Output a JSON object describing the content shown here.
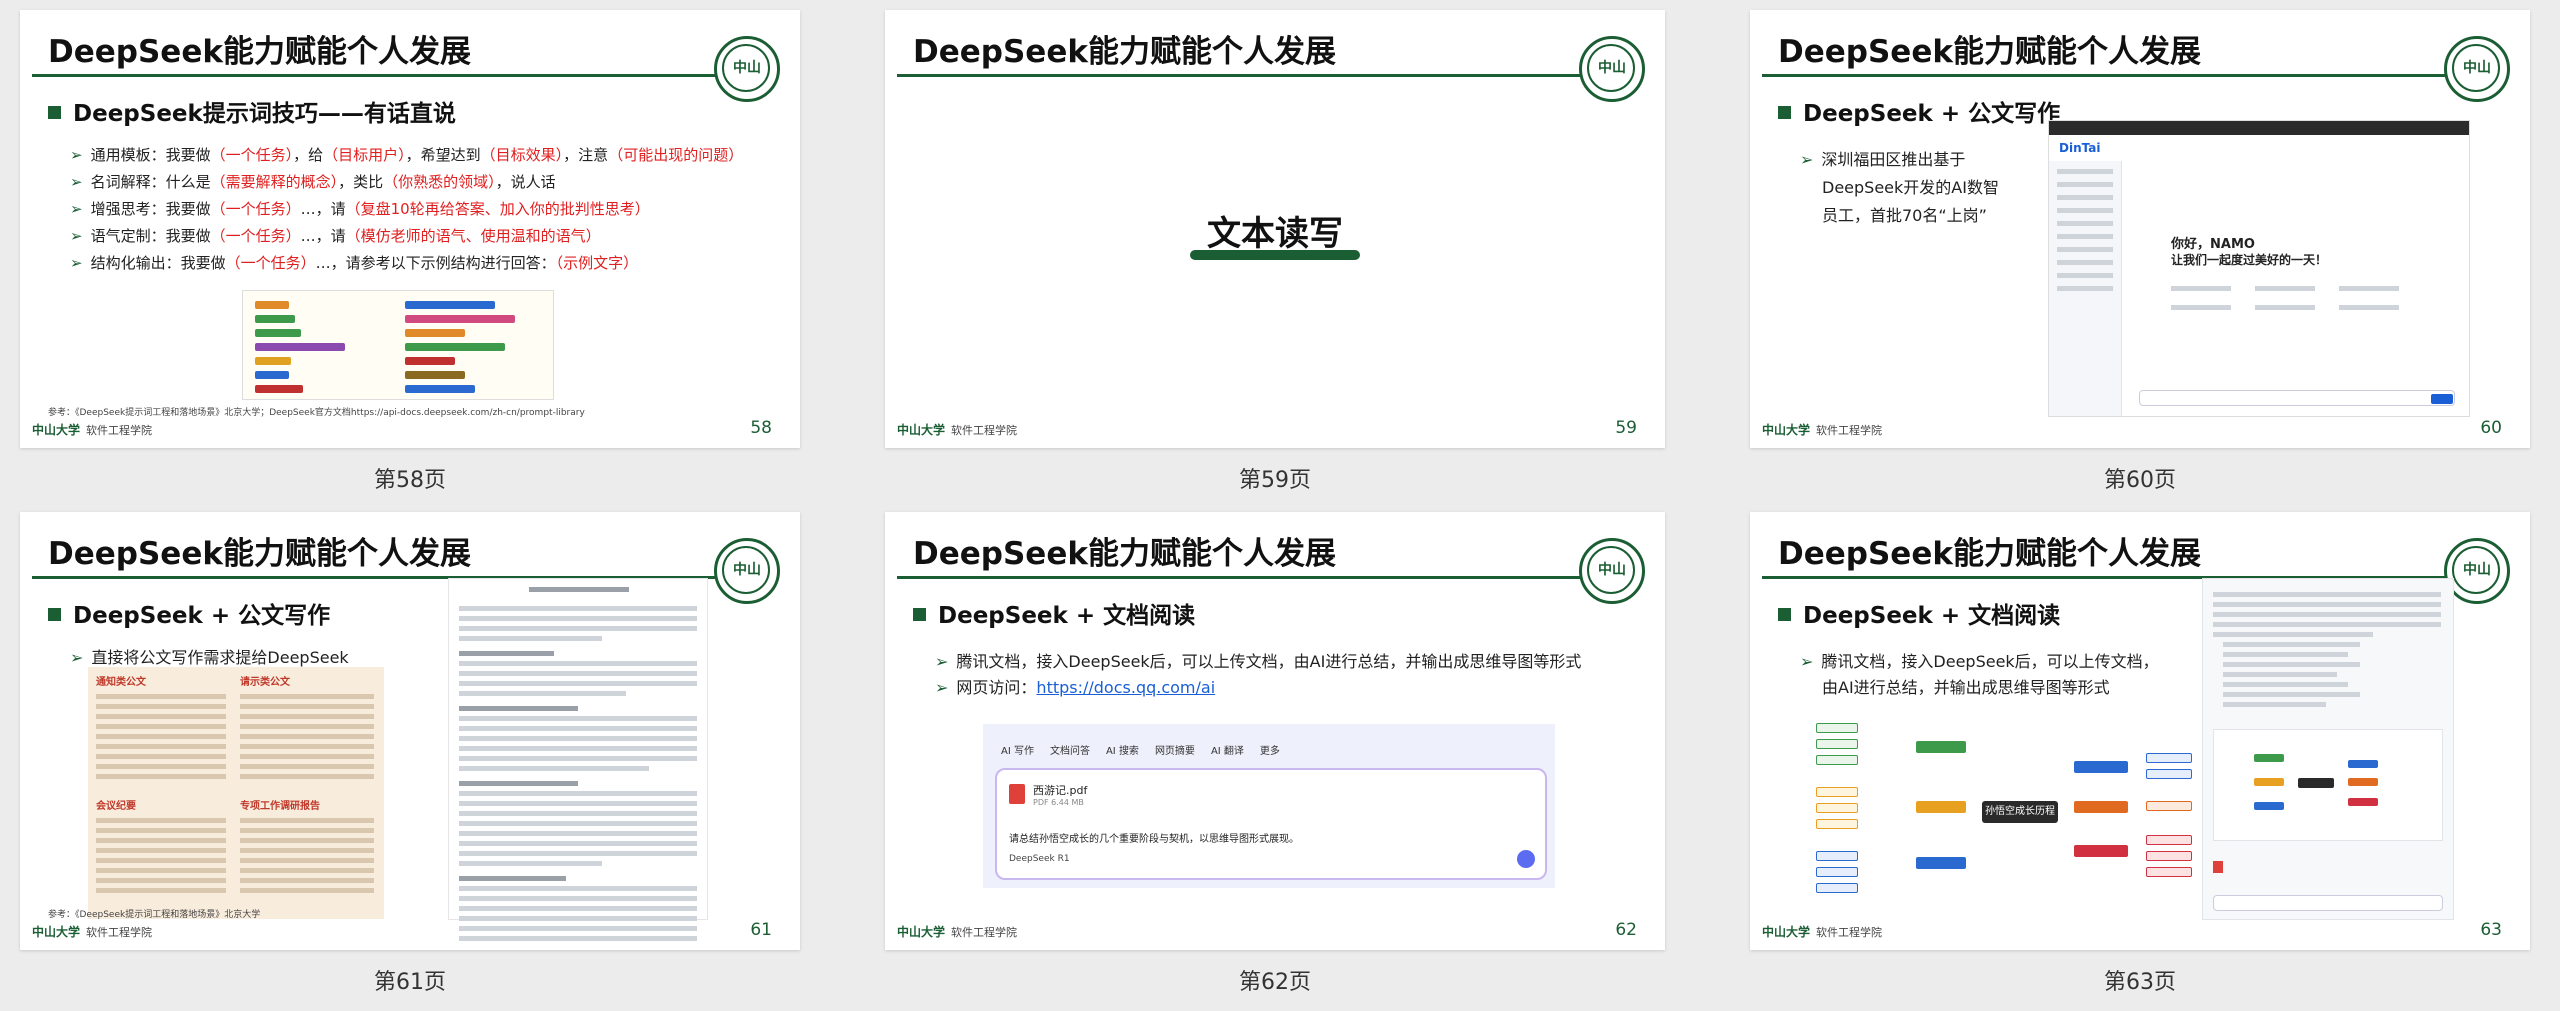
{
  "slides": [
    {
      "title": "DeepSeek能力赋能个人发展",
      "section": "DeepSeek提示词技巧——有话直说",
      "bullets": [
        {
          "prefix": "通用模板：我要做",
          "r1": "（一个任务）",
          "m1": "，给",
          "r2": "（目标用户）",
          "m2": "，希望达到",
          "r3": "（目标效果）",
          "m3": "，注意",
          "r4": "（可能出现的问题）"
        },
        {
          "prefix": "名词解释：什么是",
          "r1": "（需要解释的概念）",
          "m1": "，类比",
          "r2": "（你熟悉的领域）",
          "m2": "，说人话"
        },
        {
          "prefix": "增强思考：我要做",
          "r1": "（一个任务）",
          "m1": "…，请",
          "r2": "（复盘10轮再给答案、加入你的批判性思考）"
        },
        {
          "prefix": "语气定制：我要做",
          "r1": "（一个任务）",
          "m1": "…，请",
          "r2": "（模仿老师的语气、使用温和的语气）"
        },
        {
          "prefix": "结构化输出：我要做",
          "r1": "（一个任务）",
          "m1": "…，请参考以下示例结构进行回答：",
          "r2": "（示例文字）"
        }
      ],
      "ref": "参考：《DeepSeek提示词工程和落地场景》北京大学；DeepSeek官方文档https://api-docs.deepseek.com/zh-cn/prompt-library",
      "footer_logo": "中山大学",
      "footer_text": "软件工程学院",
      "page": "58",
      "caption": "第58页"
    },
    {
      "title": "DeepSeek能力赋能个人发展",
      "center": "文本读写",
      "footer_logo": "中山大学",
      "footer_text": "软件工程学院",
      "page": "59",
      "caption": "第59页"
    },
    {
      "title": "DeepSeek能力赋能个人发展",
      "section": "DeepSeek + 公文写作",
      "bullet_lines": [
        "深圳福田区推出基于",
        "DeepSeek开发的AI数智",
        "员工，首批70名“上岗”"
      ],
      "app_name": "DinTai",
      "app_greeting_1": "你好，NAMO",
      "app_greeting_2": "让我们一起度过美好的一天！",
      "footer_logo": "中山大学",
      "footer_text": "软件工程学院",
      "page": "60",
      "caption": "第60页"
    },
    {
      "title": "DeepSeek能力赋能个人发展",
      "section": "DeepSeek + 公文写作",
      "bullet": "直接将公文写作需求提给DeepSeek",
      "doc_labels": [
        "通知类公文",
        "请示类公文",
        "会议纪要",
        "专项工作调研报告"
      ],
      "ref": "参考：《DeepSeek提示词工程和落地场景》北京大学",
      "footer_logo": "中山大学",
      "footer_text": "软件工程学院",
      "page": "61",
      "caption": "第61页"
    },
    {
      "title": "DeepSeek能力赋能个人发展",
      "section": "DeepSeek + 文档阅读",
      "bullet1": "腾讯文档，接入DeepSeek后，可以上传文档，由AI进行总结，并输出成思维导图等形式",
      "bullet2_prefix": "网页访问：",
      "bullet2_link": "https://docs.qq.com/ai",
      "tabs": [
        "AI 写作",
        "文档问答",
        "AI 搜索",
        "网页摘要",
        "AI 翻译",
        "更多"
      ],
      "file_name": "西游记.pdf",
      "file_size": "PDF 6.44 MB",
      "prompt": "请总结孙悟空成长的几个重要阶段与契机，以思维导图形式展现。",
      "model": "DeepSeek R1",
      "footer_logo": "中山大学",
      "footer_text": "软件工程学院",
      "page": "62",
      "caption": "第62页"
    },
    {
      "title": "DeepSeek能力赋能个人发展",
      "section": "DeepSeek + 文档阅读",
      "bullet_lines": [
        "腾讯文档，接入DeepSeek后，可以上传文档，",
        "由AI进行总结，并输出成思维导图等形式"
      ],
      "mindmap_center": "孙悟空成长历程",
      "footer_logo": "中山大学",
      "footer_text": "软件工程学院",
      "page": "63",
      "caption": "第63页"
    }
  ],
  "colors": {
    "accent_green": "#1b5e34",
    "highlight_red": "#e02020",
    "link_blue": "#1a5fd6"
  }
}
